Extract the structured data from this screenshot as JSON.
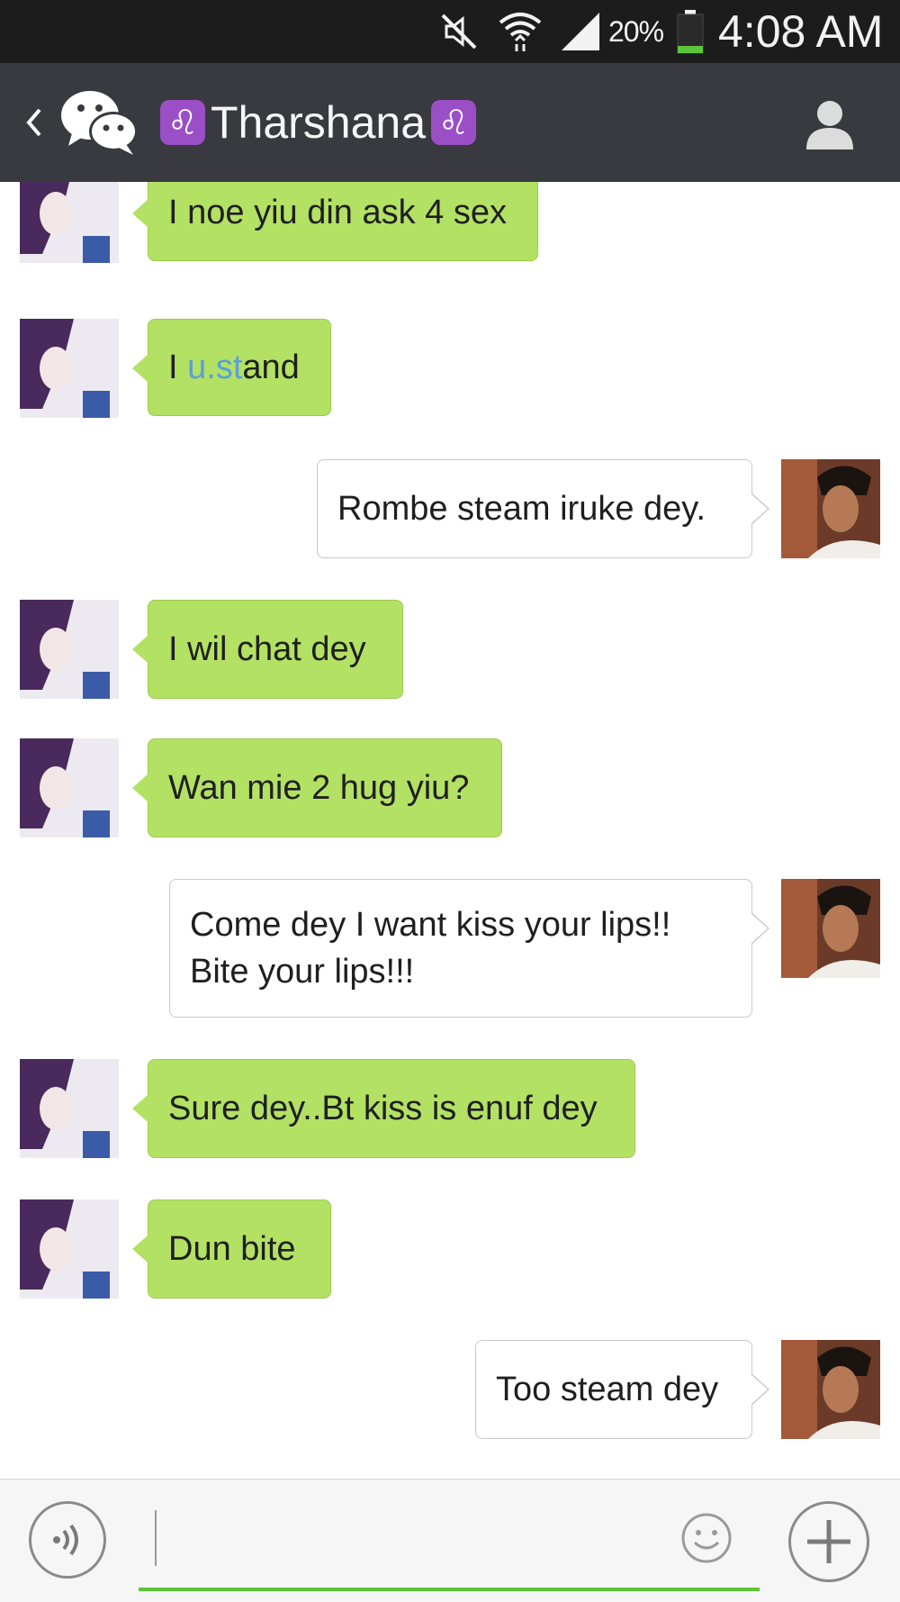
{
  "status_bar": {
    "battery_percent": "20%",
    "time": "4:08 AM",
    "icons": [
      "mute-icon",
      "wifi-icon",
      "signal-icon",
      "battery-icon"
    ]
  },
  "header": {
    "title": "Tharshana",
    "title_emoji": "♌",
    "icons": [
      "back-icon",
      "wechat-logo-icon",
      "profile-icon"
    ]
  },
  "messages": [
    {
      "sender": "contact",
      "text": "I noe yiu din ask 4 sex"
    },
    {
      "sender": "contact",
      "text_parts": [
        "I ",
        "u.st",
        "and"
      ]
    },
    {
      "sender": "me",
      "text": "Rombe steam iruke dey."
    },
    {
      "sender": "contact",
      "text": "I wil chat dey"
    },
    {
      "sender": "contact",
      "text": "Wan mie 2 hug yiu?"
    },
    {
      "sender": "me",
      "text": "Come dey I want kiss your lips!!\nBite your lips!!!"
    },
    {
      "sender": "contact",
      "text": "Sure dey..Bt kiss is enuf dey"
    },
    {
      "sender": "contact",
      "text": "Dun bite"
    },
    {
      "sender": "me",
      "text": "Too steam dey"
    }
  ],
  "input_bar": {
    "value": "",
    "icons": [
      "voice-icon",
      "emoji-icon",
      "plus-icon"
    ]
  },
  "colors": {
    "incoming_bubble": "#b3e164",
    "outgoing_bubble": "#ffffff",
    "header_bg": "#393a3f",
    "status_bg": "#1c1c1c",
    "input_underline": "#5cc43a",
    "link": "#5aa0d8"
  }
}
